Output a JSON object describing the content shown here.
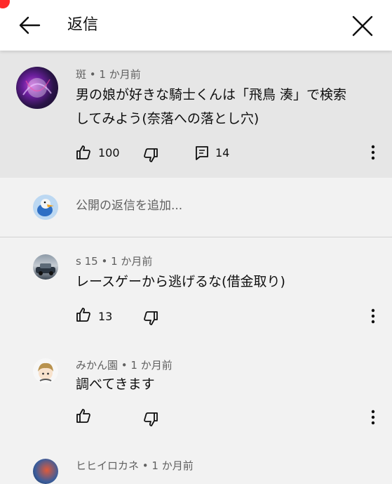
{
  "header": {
    "title": "返信",
    "back_icon": "arrow-left-icon",
    "close_icon": "close-icon"
  },
  "parent_comment": {
    "author": "斑",
    "time": "1 か月前",
    "text_line1": "男の娘が好きな騎士くんは「飛鳥 湊」で検索",
    "text_line2": "してみよう(奈落への落とし穴)",
    "likes": "100",
    "replies": "14"
  },
  "add_reply": {
    "placeholder": "公開の返信を追加..."
  },
  "replies": [
    {
      "author": "s 15",
      "time": "1 か月前",
      "text": "レースゲーから逃げるな(借金取り)",
      "likes": "13"
    },
    {
      "author": "みかん園",
      "time": "1 か月前",
      "text": "調べてきます",
      "likes": ""
    },
    {
      "author": "ヒヒイロカネ",
      "time": "1 か月前",
      "text": "",
      "likes": ""
    }
  ],
  "separator": " • ",
  "colors": {
    "header_bg": "#ffffff",
    "page_bg": "#f2f2f2",
    "highlight_bg": "#e6e6e6",
    "meta_text": "#606060",
    "recording_dot": "#ff2a2a"
  }
}
